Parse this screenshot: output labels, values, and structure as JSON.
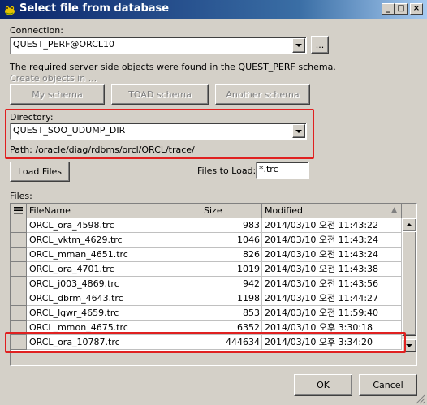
{
  "window": {
    "title": "Select file from database",
    "controls": {
      "minimize": "_",
      "maximize": "□",
      "close": "×"
    }
  },
  "connection": {
    "label": "Connection:",
    "value": "QUEST_PERF@ORCL10",
    "browse_label": "..."
  },
  "schema": {
    "message": "The required server side objects were found in the QUEST_PERF schema.",
    "create_link": "Create objects in ...",
    "buttons": [
      "My schema",
      "TOAD schema",
      "Another schema"
    ]
  },
  "directory": {
    "label": "Directory:",
    "value": "QUEST_SOO_UDUMP_DIR",
    "path": "Path:  /oracle/diag/rdbms/orcl/ORCL/trace/"
  },
  "load": {
    "button": "Load Files",
    "files_to_load_label": "Files to Load:",
    "files_to_load_value": "*.trc"
  },
  "files": {
    "label": "Files:",
    "columns": [
      "FileName",
      "Size",
      "Modified"
    ],
    "rows": [
      {
        "name": "ORCL_ora_4598.trc",
        "size": "983",
        "modified": "2014/03/10 오전 11:43:22"
      },
      {
        "name": "ORCL_vktm_4629.trc",
        "size": "1046",
        "modified": "2014/03/10 오전 11:43:24"
      },
      {
        "name": "ORCL_mman_4651.trc",
        "size": "826",
        "modified": "2014/03/10 오전 11:43:24"
      },
      {
        "name": "ORCL_ora_4701.trc",
        "size": "1019",
        "modified": "2014/03/10 오전 11:43:38"
      },
      {
        "name": "ORCL_j003_4869.trc",
        "size": "942",
        "modified": "2014/03/10 오전 11:43:56"
      },
      {
        "name": "ORCL_dbrm_4643.trc",
        "size": "1198",
        "modified": "2014/03/10 오전 11:44:27"
      },
      {
        "name": "ORCL_lgwr_4659.trc",
        "size": "853",
        "modified": "2014/03/10 오전 11:59:40"
      },
      {
        "name": "ORCL_mmon_4675.trc",
        "size": "6352",
        "modified": "2014/03/10 오후 3:30:18"
      },
      {
        "name": "ORCL_ora_10787.trc",
        "size": "444634",
        "modified": "2014/03/10 오후 3:34:20"
      }
    ]
  },
  "footer": {
    "ok": "OK",
    "cancel": "Cancel"
  },
  "colors": {
    "title_start": "#0a246a",
    "title_end": "#a6caf0",
    "highlight": "#e02020",
    "face": "#d4d0c8"
  }
}
